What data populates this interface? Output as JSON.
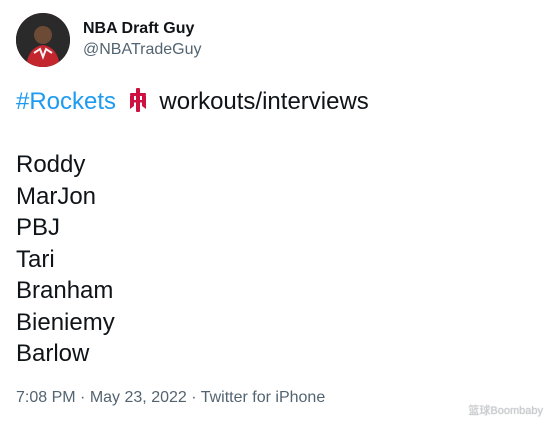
{
  "author": {
    "display_name": "NBA Draft Guy",
    "handle": "@NBATradeGuy",
    "avatar_icon": "player-avatar"
  },
  "tweet": {
    "hashtag": "#Rockets",
    "emoji_icon": "rockets-logo-icon",
    "headline_rest": "workouts/interviews",
    "names": [
      "Roddy",
      "MarJon",
      "PBJ",
      "Tari",
      "Branham",
      "Bieniemy",
      "Barlow"
    ]
  },
  "meta": {
    "time": "7:08 PM",
    "separator": "·",
    "date": "May 23, 2022",
    "source": "Twitter for iPhone"
  },
  "watermark": "篮球Boombaby",
  "colors": {
    "hashtag": "#1d9bf0",
    "text": "#0f1419",
    "secondary": "#536471",
    "rockets_red": "#ce1141"
  }
}
